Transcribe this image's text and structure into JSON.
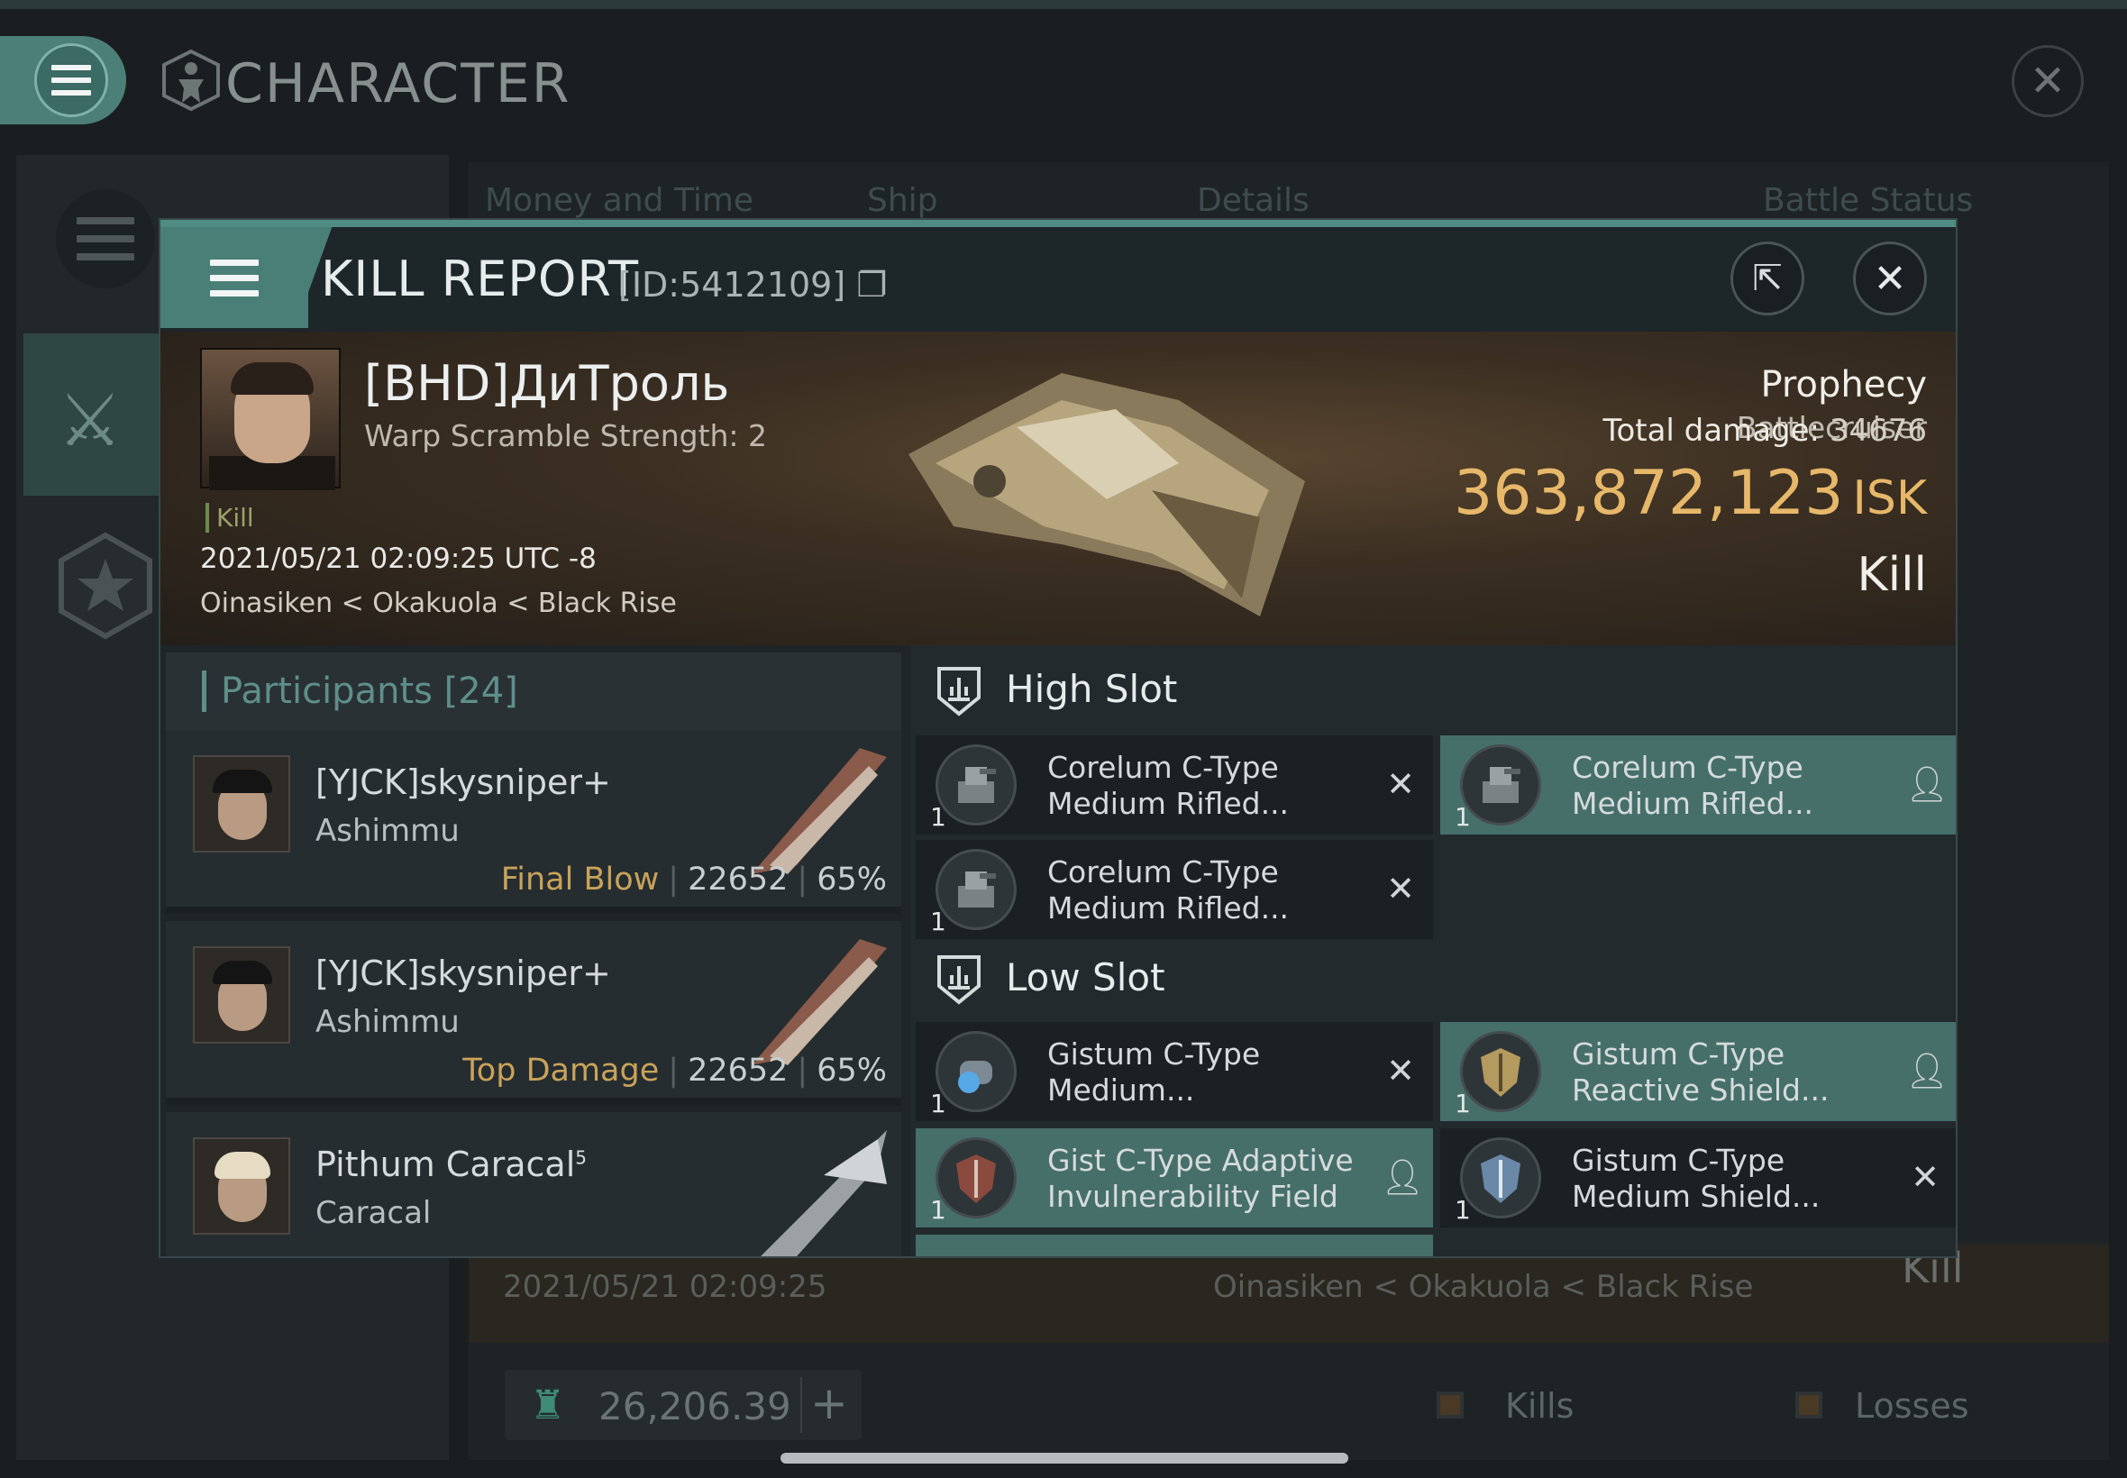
{
  "background_screen": {
    "title": "CHARACTER",
    "columns": [
      "Money and Time",
      "Ship",
      "Details",
      "Battle Status"
    ],
    "bottom_row": {
      "date": "2021/05/21  02:09:25",
      "location": "Oinasiken < Okakuola < Black Rise",
      "status": "Kill"
    },
    "wallet_value": "26,206.39",
    "filters": [
      "Kills",
      "Losses"
    ]
  },
  "kill_report": {
    "title": "KILL REPORT",
    "report_id": "[ID:5412109]",
    "victim": {
      "name": "[BHD]ДиТроль",
      "warp_scramble": "Warp Scramble Strength: 2",
      "tag": "Kill",
      "datetime": "2021/05/21 02:09:25 UTC -8",
      "location": "Oinasiken < Okakuola < Black Rise"
    },
    "ship": {
      "name": "Prophecy",
      "class": "Battlecruiser",
      "total_damage_label": "Total damage:",
      "total_damage_value": "34676",
      "isk_value": "363,872,123",
      "isk_unit": "ISK",
      "result": "Kill"
    },
    "participants": {
      "header": "Participants [24]",
      "rows": [
        {
          "name": "[YJCK]skysniper+",
          "ship": "Ashimmu",
          "role": "Final Blow",
          "damage": "22652",
          "percent": "65%"
        },
        {
          "name": "[YJCK]skysniper+",
          "ship": "Ashimmu",
          "role": "Top Damage",
          "damage": "22652",
          "percent": "65%"
        },
        {
          "name": "Pithum Caracal",
          "name_sup": "5",
          "ship": "Caracal"
        }
      ]
    },
    "high_slot": {
      "title": "High Slot",
      "items": [
        {
          "name": "Corelum C-Type Medium Rifled...",
          "qty": "1",
          "status_icon": "destroyed-x-icon",
          "dropped": false
        },
        {
          "name": "Corelum C-Type Medium Rifled...",
          "qty": "1",
          "status_icon": "person-icon",
          "dropped": true
        },
        {
          "name": "Corelum C-Type Medium Rifled...",
          "qty": "1",
          "status_icon": "destroyed-x-icon",
          "dropped": false
        }
      ]
    },
    "low_slot": {
      "title": "Low Slot",
      "items": [
        {
          "name": "Gistum C-Type Medium...",
          "qty": "1",
          "status_icon": "destroyed-x-icon",
          "dropped": false
        },
        {
          "name": "Gistum C-Type Reactive Shield...",
          "qty": "1",
          "status_icon": "person-icon",
          "dropped": true
        },
        {
          "name": "Gist C-Type Adaptive Invulnerability Field",
          "qty": "1",
          "status_icon": "person-icon",
          "dropped": true
        },
        {
          "name": "Gistum C-Type Medium Shield...",
          "qty": "1",
          "status_icon": "destroyed-x-icon",
          "dropped": false
        }
      ]
    }
  },
  "colors": {
    "accent_teal": "#4f8d84",
    "dropped_item": "#466f6a",
    "isk_gold": "#e7b86a",
    "role_gold": "#c9a35a"
  }
}
